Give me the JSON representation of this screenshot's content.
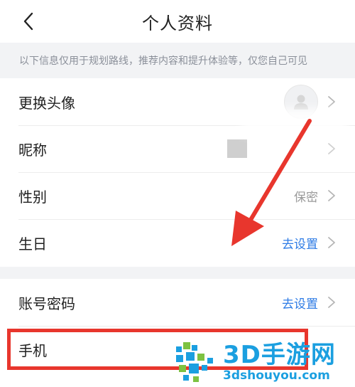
{
  "header": {
    "title": "个人资料",
    "back_icon": "chevron-left-icon"
  },
  "notice": "以下信息仅用于规划路线，推荐内容和提升体验等，仅您自己可见",
  "profile_group": {
    "items": [
      {
        "label": "更换头像",
        "value": "",
        "icon": "avatar-placeholder-icon"
      },
      {
        "label": "昵称",
        "value": ""
      },
      {
        "label": "性别",
        "value": "保密"
      },
      {
        "label": "生日",
        "value": "去设置"
      }
    ]
  },
  "account_group": {
    "items": [
      {
        "label": "账号密码",
        "value": "去设置"
      },
      {
        "label": "手机",
        "value": ""
      }
    ]
  },
  "watermark": {
    "title": "3D手游网",
    "subtitle": "3dshouyou.com"
  },
  "colors": {
    "accent_blue": "#2d7be5",
    "annotation_red": "#e8362d",
    "watermark_blue": "#1b9fe0"
  }
}
